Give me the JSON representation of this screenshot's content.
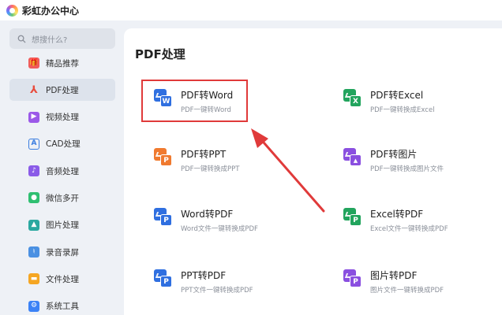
{
  "app": {
    "title": "彩虹办公中心"
  },
  "search": {
    "placeholder": "想搜什么?"
  },
  "sidebar": {
    "items": [
      {
        "label": "精品推荐",
        "icon": "gift-icon",
        "color": "#f05b5b"
      },
      {
        "label": "PDF处理",
        "icon": "pdf-icon",
        "color": "#e84c3d",
        "active": true
      },
      {
        "label": "视频处理",
        "icon": "video-icon",
        "color": "#9b59e8"
      },
      {
        "label": "CAD处理",
        "icon": "cad-icon",
        "color": "#3a7de0"
      },
      {
        "label": "音频处理",
        "icon": "music-icon",
        "color": "#8a5be8"
      },
      {
        "label": "微信多开",
        "icon": "wechat-icon",
        "color": "#2fbf71"
      },
      {
        "label": "图片处理",
        "icon": "image-icon",
        "color": "#2aa8a0"
      },
      {
        "label": "录音录屏",
        "icon": "mic-icon",
        "color": "#4a90e2"
      },
      {
        "label": "文件处理",
        "icon": "folder-icon",
        "color": "#f5a623"
      },
      {
        "label": "系统工具",
        "icon": "gear-icon",
        "color": "#3b82f6"
      }
    ]
  },
  "main": {
    "title": "PDF处理",
    "cards": [
      {
        "name": "PDF转Word",
        "desc": "PDF一键转Word",
        "badge": "W",
        "color": "#2f6fe0",
        "icon": "pdf-to-word-icon"
      },
      {
        "name": "PDF转Excel",
        "desc": "PDF一键转换成Excel",
        "badge": "X",
        "color": "#22a45d",
        "icon": "pdf-to-excel-icon"
      },
      {
        "name": "PDF转PPT",
        "desc": "PDF一键转换成PPT",
        "badge": "P",
        "color": "#f07a2f",
        "icon": "pdf-to-ppt-icon"
      },
      {
        "name": "PDF转图片",
        "desc": "PDF一键转换成图片文件",
        "badge": "▲",
        "color": "#8a4fe0",
        "icon": "pdf-to-image-icon"
      },
      {
        "name": "Word转PDF",
        "desc": "Word文件一键转换成PDF",
        "badge": "P",
        "color": "#2f6fe0",
        "icon": "word-to-pdf-icon"
      },
      {
        "name": "Excel转PDF",
        "desc": "Excel文件一键转换成PDF",
        "badge": "P",
        "color": "#22a45d",
        "icon": "excel-to-pdf-icon"
      },
      {
        "name": "PPT转PDF",
        "desc": "PPT文件一键转换成PDF",
        "badge": "P",
        "color": "#2f6fe0",
        "icon": "ppt-to-pdf-icon"
      },
      {
        "name": "图片转PDF",
        "desc": "图片文件一键转换成PDF",
        "badge": "P",
        "color": "#8a4fe0",
        "icon": "image-to-pdf-icon"
      }
    ]
  },
  "colors": {
    "highlight": "#e03a3a",
    "active_bg": "#dde3ec"
  }
}
